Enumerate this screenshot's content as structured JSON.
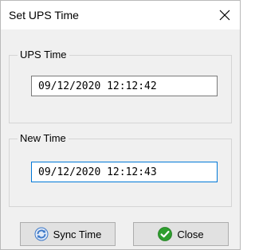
{
  "window": {
    "title": "Set UPS Time",
    "close_glyph": "✕"
  },
  "ups_time": {
    "label": "UPS Time",
    "value": "09/12/2020 12:12:42"
  },
  "new_time": {
    "label": "New Time",
    "value": "09/12/2020 12:12:43"
  },
  "buttons": {
    "sync": {
      "label": "Sync Time",
      "icon": "sync-icon"
    },
    "close": {
      "label": "Close",
      "icon": "check-circle-icon"
    }
  },
  "colors": {
    "focus_border": "#0078d7",
    "close_icon_green": "#2e9e2e",
    "sync_icon_blue": "#3c78c8"
  }
}
